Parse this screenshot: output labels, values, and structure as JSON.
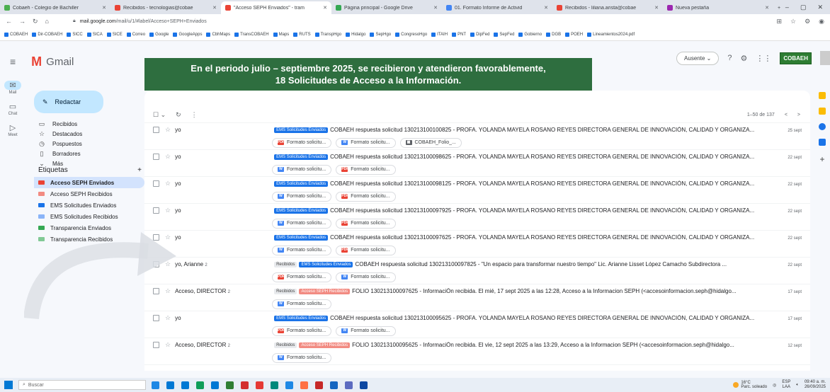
{
  "browser": {
    "tabs": [
      {
        "label": "Cobaeh - Colegio de Bachiller",
        "color": "#4caf50",
        "active": false
      },
      {
        "label": "Recibidos - tecnologias@cobae",
        "color": "#ea4335",
        "active": false
      },
      {
        "label": "\"Acceso SEPH Enviados\" - tram",
        "color": "#ea4335",
        "active": true
      },
      {
        "label": "Página principal - Google Drive",
        "color": "#34a853",
        "active": false
      },
      {
        "label": "01. Formato Informe de Activid",
        "color": "#4285f4",
        "active": false
      },
      {
        "label": "Recibidos - liliana.arista@cobae",
        "color": "#ea4335",
        "active": false
      },
      {
        "label": "Nueva pestaña",
        "color": "#9c27b0",
        "active": false
      }
    ],
    "url_host": "mail.google.com",
    "url_path": "/mail/u/1/#label/Acceso+SEPH+Enviados",
    "bookmarks": [
      "COBAEH",
      "Dir-COBAEH",
      "SICC",
      "SICA",
      "SICE",
      "Correo",
      "Google",
      "GoogleApps",
      "CbhMaps",
      "TransCOBAEH",
      "Maps",
      "RUTS",
      "TranspHgo",
      "Hidalgo",
      "SepHgo",
      "CongresoHgo",
      "ITAIH",
      "PNT",
      "DipFed",
      "SepFed",
      "Gobierno",
      "DGB",
      "POEH",
      "Lineamientos2024.pdf"
    ]
  },
  "gmail": {
    "app_name": "Gmail",
    "status_label": "Ausente",
    "org_logo": "COBAEH",
    "compose_label": "Redactar",
    "rail": [
      {
        "label": "Mail",
        "icon": "mail-icon"
      },
      {
        "label": "Chat",
        "icon": "chat-icon"
      },
      {
        "label": "Meet",
        "icon": "meet-icon"
      }
    ],
    "nav": [
      {
        "label": "Recibidos",
        "glyph": "▭"
      },
      {
        "label": "Destacados",
        "glyph": "☆"
      },
      {
        "label": "Pospuestos",
        "glyph": "◷"
      },
      {
        "label": "Borradores",
        "glyph": "▯"
      },
      {
        "label": "Más",
        "glyph": "⌄"
      }
    ],
    "labels_title": "Etiquetas",
    "labels_add": "+",
    "labels": [
      {
        "label": "Acceso SEPH Enviados",
        "color": "#ea4335",
        "active": true
      },
      {
        "label": "Acceso SEPH Recibidos",
        "color": "#f28b82",
        "active": false
      },
      {
        "label": "EMS Solicitudes Enviados",
        "color": "#1a73e8",
        "active": false
      },
      {
        "label": "EMS Solicitudes Recibidos",
        "color": "#8ab4f8",
        "active": false
      },
      {
        "label": "Transparencia Enviados",
        "color": "#34a853",
        "active": false
      },
      {
        "label": "Transparencia Recibidos",
        "color": "#81c995",
        "active": false
      }
    ],
    "pager": "1–50 de 137",
    "pager_prev": "<",
    "pager_next": ">"
  },
  "banner": {
    "line1": "En el periodo julio – septiembre 2025, se recibieron y atendieron favorablemente,",
    "line2": "18 Solicitudes de Acceso a la Información."
  },
  "messages": [
    {
      "sender": "yo",
      "count": "",
      "badges": [
        {
          "text": "EMS Solicitudes Enviados",
          "kind": "ems"
        }
      ],
      "subject": "COBAEH respuesta solicitud 130213100100825 - PROFA. YOLANDA MAYELA ROSANO REYES DIRECTORA GENERAL DE INNOVACIÓN, CALIDAD Y ORGANIZA...",
      "date": "25 sept",
      "attachments": [
        {
          "name": "Formato solicitu...",
          "type": "pdf"
        },
        {
          "name": "Formato solicitu...",
          "type": "word"
        },
        {
          "name": "COBAEH_Folio_...",
          "type": "zip"
        }
      ]
    },
    {
      "sender": "yo",
      "count": "",
      "badges": [
        {
          "text": "EMS Solicitudes Enviados",
          "kind": "ems"
        }
      ],
      "subject": "COBAEH respuesta solicitud 130213100098625 - PROFA. YOLANDA MAYELA ROSANO REYES DIRECTORA GENERAL DE INNOVACIÓN, CALIDAD Y ORGANIZA...",
      "date": "22 sept",
      "attachments": [
        {
          "name": "Formato solicitu...",
          "type": "word"
        },
        {
          "name": "Formato solicitu...",
          "type": "pdf"
        }
      ]
    },
    {
      "sender": "yo",
      "count": "",
      "badges": [
        {
          "text": "EMS Solicitudes Enviados",
          "kind": "ems"
        }
      ],
      "subject": "COBAEH respuesta solicitud 130213100098125 - PROFA. YOLANDA MAYELA ROSANO REYES DIRECTORA GENERAL DE INNOVACIÓN, CALIDAD Y ORGANIZA...",
      "date": "22 sept",
      "attachments": [
        {
          "name": "Formato solicitu...",
          "type": "word"
        },
        {
          "name": "Formato solicitu...",
          "type": "pdf"
        }
      ]
    },
    {
      "sender": "yo",
      "count": "",
      "badges": [
        {
          "text": "EMS Solicitudes Enviados",
          "kind": "ems"
        }
      ],
      "subject": "COBAEH respuesta solicitud 130213100097925 - PROFA. YOLANDA MAYELA ROSANO REYES DIRECTORA GENERAL DE INNOVACIÓN, CALIDAD Y ORGANIZA...",
      "date": "22 sept",
      "attachments": [
        {
          "name": "Formato solicitu...",
          "type": "word"
        },
        {
          "name": "Formato solicitu...",
          "type": "pdf"
        }
      ]
    },
    {
      "sender": "yo",
      "count": "",
      "badges": [
        {
          "text": "EMS Solicitudes Enviados",
          "kind": "ems"
        }
      ],
      "subject": "COBAEH respuesta solicitud 130213100097625 - PROFA. YOLANDA MAYELA ROSANO REYES DIRECTORA GENERAL DE INNOVACIÓN, CALIDAD Y ORGANIZA...",
      "date": "22 sept",
      "attachments": [
        {
          "name": "Formato solicitu...",
          "type": "word"
        },
        {
          "name": "Formato solicitu...",
          "type": "pdf"
        }
      ]
    },
    {
      "sender": "yo, Arianne",
      "count": "2",
      "badges": [
        {
          "text": "Recibidos",
          "kind": "rec"
        },
        {
          "text": "EMS Solicitudes Enviados",
          "kind": "ems"
        }
      ],
      "subject": "COBAEH respuesta solicitud 130213100097825 - \"Un espacio para transformar nuestro tiempo\" Lic. Arianne Lisset López Camacho Subdirectora ...",
      "date": "22 sept",
      "attachments": [
        {
          "name": "Formato solicitu...",
          "type": "pdf"
        },
        {
          "name": "Formato solicitu...",
          "type": "word"
        }
      ]
    },
    {
      "sender": "Acceso, DIRECTOR",
      "count": "2",
      "badges": [
        {
          "text": "Recibidos",
          "kind": "rec"
        },
        {
          "text": "Acceso SEPH Recibidos",
          "kind": "acc"
        }
      ],
      "subject": "FOLIO 130213100097625 - InformaciÓn recibida. El mié, 17 sept 2025 a las 12:28, Acceso a la Informacion SEPH (<accesoinformacion.seph@hidalgo...",
      "date": "17 sept",
      "attachments": [
        {
          "name": "Formato solicitu...",
          "type": "word"
        }
      ]
    },
    {
      "sender": "yo",
      "count": "",
      "badges": [
        {
          "text": "EMS Solicitudes Enviados",
          "kind": "ems"
        }
      ],
      "subject": "COBAEH respuesta solicitud 130213100095625 - PROFA. YOLANDA MAYELA ROSANO REYES DIRECTORA GENERAL DE INNOVACIÓN, CALIDAD Y ORGANIZA...",
      "date": "17 sept",
      "attachments": [
        {
          "name": "Formato solicitu...",
          "type": "pdf"
        },
        {
          "name": "Formato solicitu...",
          "type": "word"
        }
      ]
    },
    {
      "sender": "Acceso, DIRECTOR",
      "count": "2",
      "badges": [
        {
          "text": "Recibidos",
          "kind": "rec"
        },
        {
          "text": "Acceso SEPH Recibidos",
          "kind": "acc"
        }
      ],
      "subject": "FOLIO 130213100095625 - InformaciÓn recibida. El vie, 12 sept 2025 a las 13:29, Acceso a la Informacion SEPH (<accesoinformacion.seph@hidalgo...",
      "date": "12 sept",
      "attachments": [
        {
          "name": "Formato solicitu...",
          "type": "word"
        }
      ]
    }
  ],
  "taskbar": {
    "search_placeholder": "Buscar",
    "apps": [
      "#1e88e5",
      "#0078d4",
      "#0078d4",
      "#0f9d58",
      "#0078d4",
      "#2e7d32",
      "#d32f2f",
      "#e53935",
      "#00897b",
      "#1e88e5",
      "#ff7043",
      "#c62828",
      "#1565c0",
      "#5c6bc0",
      "#0d47a1"
    ],
    "weather_temp": "16°C",
    "weather_desc": "Parc. soleado",
    "lang": "ESP",
    "lang_sub": "LAA",
    "time": "09:40 a. m.",
    "date": "26/09/2025"
  }
}
